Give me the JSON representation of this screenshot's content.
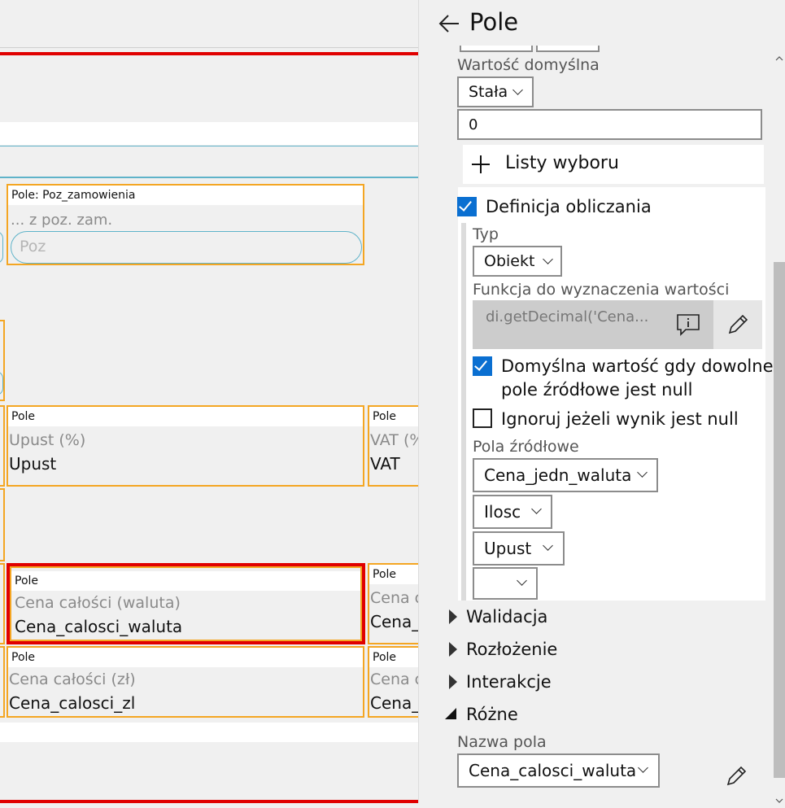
{
  "panel": {
    "title": "Pole",
    "default_value": {
      "label": "Wartość domyślna",
      "mode": "Stała",
      "value": "0"
    },
    "choice_lists_label": "Listy wyboru",
    "calc_definition": {
      "label": "Definicja obliczania",
      "checked": true,
      "type_label": "Typ",
      "type_value": "Obiekt",
      "function_label": "Funkcja do wyznaczenia wartości",
      "function_value": "di.getDecimal('Cena...",
      "default_if_null_line1": "Domyślna wartość gdy dowolne",
      "default_if_null_line2": "pole źródłowe jest null",
      "default_if_null_checked": true,
      "ignore_if_null": "Ignoruj jeżeli wynik jest null",
      "ignore_if_null_checked": false,
      "source_fields_label": "Pola źródłowe",
      "source_fields": [
        "Cena_jedn_waluta",
        "Ilosc",
        "Upust",
        ""
      ]
    },
    "sections": {
      "validation": "Walidacja",
      "layout": "Rozłożenie",
      "interactions": "Interakcje",
      "misc": "Różne"
    },
    "field_name_label": "Nazwa pola",
    "field_name_value": "Cena_calosci_waluta"
  },
  "canvas": {
    "poz": {
      "type": "Pole: Poz_zamowienia",
      "caption": "... z poz. zam.",
      "placeholder": "Poz"
    },
    "upust": {
      "type": "Pole",
      "caption": "Upust (%)",
      "value": "Upust"
    },
    "vat": {
      "type": "Pole",
      "caption": "VAT (%",
      "value": "VAT"
    },
    "cena_waluta": {
      "type": "Pole",
      "caption": "Cena całości (waluta)",
      "value": "Cena_calosci_waluta"
    },
    "cena_c1": {
      "type": "Pole",
      "caption": "Cena c",
      "value": "Cena_"
    },
    "cena_zl": {
      "type": "Pole",
      "caption": "Cena całości (zł)",
      "value": "Cena_calosci_zl"
    },
    "cena_c2": {
      "type": "Pole",
      "caption": "Cena c",
      "value": "Cena_"
    }
  },
  "colors": {
    "accent": "#0a6fd1",
    "field_border": "#f4a623",
    "selected_border": "#e00000",
    "panel_bg": "#f0f0f0"
  }
}
